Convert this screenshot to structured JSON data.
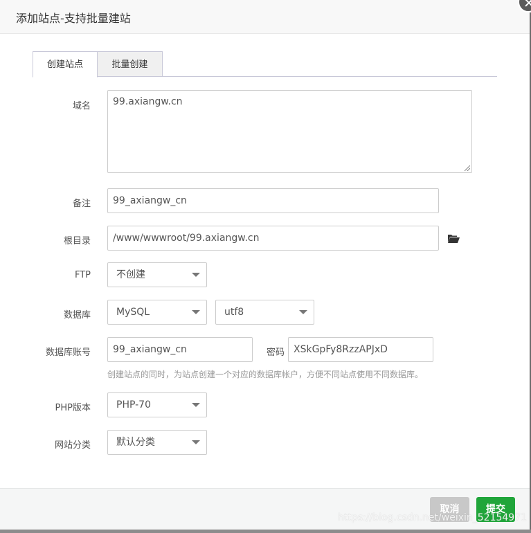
{
  "dialog": {
    "title": "添加站点-支持批量建站",
    "close_icon": "close-icon"
  },
  "tabs": [
    {
      "label": "创建站点",
      "active": true
    },
    {
      "label": "批量创建",
      "active": false
    }
  ],
  "form": {
    "domain": {
      "label": "域名",
      "value": "99.axiangw.cn"
    },
    "remark": {
      "label": "备注",
      "value": "99_axiangw_cn"
    },
    "root_dir": {
      "label": "根目录",
      "value": "/www/wwwroot/99.axiangw.cn",
      "icon": "folder-open-icon"
    },
    "ftp": {
      "label": "FTP",
      "selected": "不创建"
    },
    "database": {
      "label": "数据库",
      "type_selected": "MySQL",
      "charset_selected": "utf8"
    },
    "db_account": {
      "label": "数据库账号",
      "value": "99_axiangw_cn",
      "password_label": "密码",
      "password_value": "XSkGpFy8RzzAPJxD",
      "hint": "创建站点的同时，为站点创建一个对应的数据库帐户，方便不同站点使用不同数据库。"
    },
    "php_version": {
      "label": "PHP版本",
      "selected": "PHP-70"
    },
    "category": {
      "label": "网站分类",
      "selected": "默认分类"
    }
  },
  "footer": {
    "cancel_label": "取消",
    "submit_label": "提交"
  },
  "watermark": "https://blog.csdn.net/weixin_52154971",
  "colors": {
    "submit": "#20a53a",
    "cancel": "#c8c8c8"
  }
}
